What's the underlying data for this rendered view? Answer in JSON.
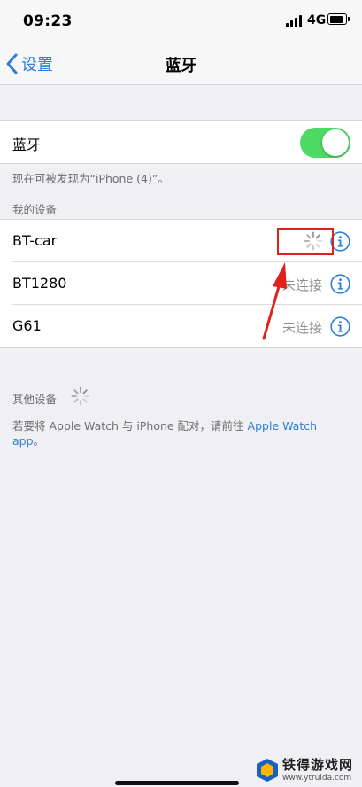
{
  "status_bar": {
    "time": "09:23",
    "network": "4G",
    "battery_level": 0.85
  },
  "nav": {
    "back_label": "设置",
    "title": "蓝牙"
  },
  "bluetooth": {
    "label": "蓝牙",
    "enabled": true,
    "discoverable_note": "现在可被发现为“iPhone (4)”。"
  },
  "my_devices": {
    "header": "我的设备",
    "items": [
      {
        "name": "BT-car",
        "status": ""
      },
      {
        "name": "BT1280",
        "status": "未连接"
      },
      {
        "name": "G61",
        "status": "未连接"
      }
    ]
  },
  "other_devices": {
    "header": "其他设备",
    "note_prefix": "若要将 Apple Watch 与 iPhone 配对，请前往 ",
    "note_link": "Apple Watch",
    "note_link_cont": "app",
    "note_suffix": "。"
  },
  "watermark": {
    "title": "铁得游戏网",
    "url": "www.ytruida.com"
  },
  "colors": {
    "accent": "#2f7fd8",
    "toggle_on": "#4cd964",
    "annotation": "#e0201b"
  }
}
